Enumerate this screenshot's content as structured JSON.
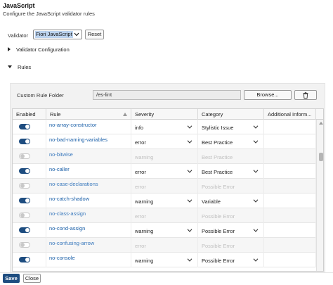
{
  "header": {
    "title": "JavaScript",
    "subtitle": "Configure the JavaScript validator rules"
  },
  "validator": {
    "label": "Validator",
    "selected": "Fiori JavaScript",
    "reset_label": "Reset"
  },
  "sections": {
    "config_label": "Validator Configuration",
    "rules_label": "Rules"
  },
  "folder": {
    "label": "Custom Rule Folder",
    "value": "/es-lint",
    "browse_label": "Browse..."
  },
  "table": {
    "columns": [
      "Enabled",
      "Rule",
      "Severity",
      "Category",
      "Additional Inform..."
    ],
    "rows": [
      {
        "enabled": true,
        "rule": "no-array-constructor",
        "severity": "info",
        "category": "Stylistic Issue"
      },
      {
        "enabled": true,
        "rule": "no-bad-naming-variables",
        "severity": "error",
        "category": "Best Practice"
      },
      {
        "enabled": false,
        "rule": "no-bitwise",
        "severity": "warning",
        "category": "Best Practice"
      },
      {
        "enabled": true,
        "rule": "no-caller",
        "severity": "error",
        "category": "Best Practice"
      },
      {
        "enabled": false,
        "rule": "no-case-declarations",
        "severity": "error",
        "category": "Possible Error"
      },
      {
        "enabled": true,
        "rule": "no-catch-shadow",
        "severity": "warning",
        "category": "Variable"
      },
      {
        "enabled": false,
        "rule": "no-class-assign",
        "severity": "error",
        "category": "Possible Error"
      },
      {
        "enabled": true,
        "rule": "no-cond-assign",
        "severity": "warning",
        "category": "Possible Error"
      },
      {
        "enabled": false,
        "rule": "no-confusing-arrow",
        "severity": "error",
        "category": "Possible Error"
      },
      {
        "enabled": true,
        "rule": "no-console",
        "severity": "warning",
        "category": "Possible Error"
      }
    ]
  },
  "footer": {
    "save_label": "Save",
    "close_label": "Close"
  },
  "colors": {
    "primary": "#1e4d80",
    "link": "#1a5fa8",
    "disabled_text": "#c0c0c0"
  }
}
